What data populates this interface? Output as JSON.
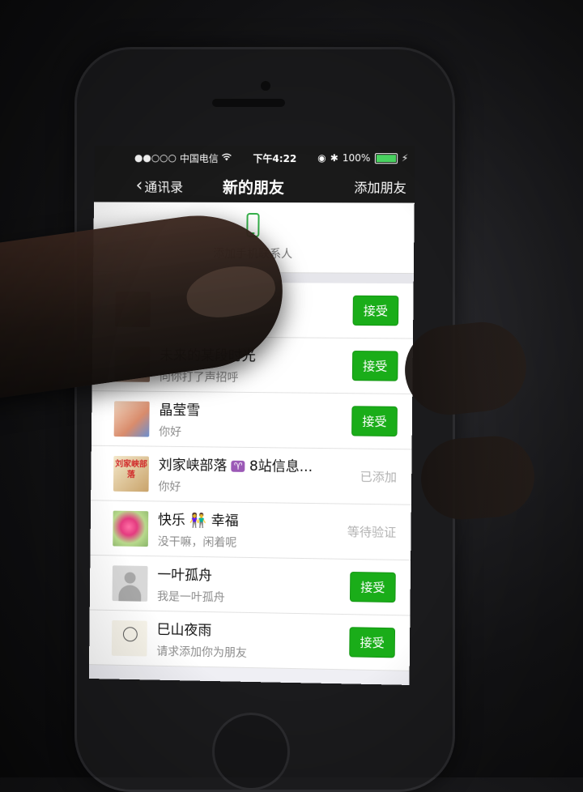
{
  "status_bar": {
    "signal": "●●○○○",
    "carrier": "中国电信",
    "wifi_icon": "wifi-icon",
    "time": "下午4:22",
    "battery_percent": "100%",
    "battery_level": 1.0
  },
  "nav": {
    "back_label": "通讯录",
    "title": "新的朋友",
    "right_label": "添加朋友"
  },
  "add_contacts": {
    "label": "添加手机联系人",
    "icon": "mobile-phone-icon"
  },
  "requests": [
    {
      "name": "",
      "message": "",
      "action": "接受",
      "action_type": "button"
    },
    {
      "name": "未来的某段时光",
      "message": "向你打了声招呼",
      "action": "接受",
      "action_type": "button"
    },
    {
      "name": "晶莹雪",
      "message": "你好",
      "action": "接受",
      "action_type": "button"
    },
    {
      "name": "刘家峡部落",
      "tag": "♈",
      "name_suffix": "8站信息...",
      "avatar_text": "刘家峡部落",
      "message": "你好",
      "action": "已添加",
      "action_type": "status"
    },
    {
      "name": "快乐",
      "emoji": "👫",
      "name_suffix": "幸福",
      "message": "没干嘛，闲着呢",
      "action": "等待验证",
      "action_type": "status"
    },
    {
      "name": "一叶孤舟",
      "message": "我是一叶孤舟",
      "action": "接受",
      "action_type": "button"
    },
    {
      "name": "巳山夜雨",
      "message": "请求添加你为朋友",
      "action": "接受",
      "action_type": "button"
    }
  ],
  "colors": {
    "accept_green": "#1aad19",
    "nav_bg": "#1a1a1a",
    "icon_green": "#35b14a"
  }
}
